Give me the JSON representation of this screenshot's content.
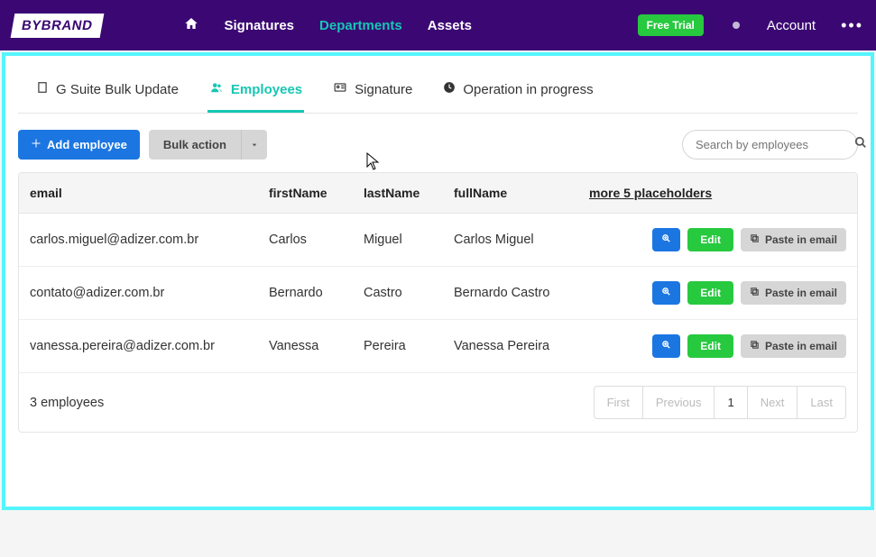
{
  "brand": "BYBRAND",
  "nav": {
    "signatures": "Signatures",
    "departments": "Departments",
    "assets": "Assets"
  },
  "topbar": {
    "free_trial": "Free Trial",
    "account": "Account"
  },
  "tabs": {
    "gsuite": "G Suite Bulk Update",
    "employees": "Employees",
    "signature": "Signature",
    "operation": "Operation in progress"
  },
  "toolbar": {
    "add_employee": "Add employee",
    "bulk_action": "Bulk action",
    "search_placeholder": "Search by employees"
  },
  "table": {
    "headers": {
      "email": "email",
      "firstName": "firstName",
      "lastName": "lastName",
      "fullName": "fullName",
      "more": "more 5 placeholders"
    },
    "rows": [
      {
        "email": "carlos.miguel@adizer.com.br",
        "firstName": "Carlos",
        "lastName": "Miguel",
        "fullName": "Carlos Miguel"
      },
      {
        "email": "contato@adizer.com.br",
        "firstName": "Bernardo",
        "lastName": "Castro",
        "fullName": "Bernardo Castro"
      },
      {
        "email": "vanessa.pereira@adizer.com.br",
        "firstName": "Vanessa",
        "lastName": "Pereira",
        "fullName": "Vanessa Pereira"
      }
    ],
    "actions": {
      "edit": "Edit",
      "paste": "Paste in email"
    },
    "footer_count": "3 employees",
    "pager": {
      "first": "First",
      "previous": "Previous",
      "page": "1",
      "next": "Next",
      "last": "Last"
    }
  }
}
